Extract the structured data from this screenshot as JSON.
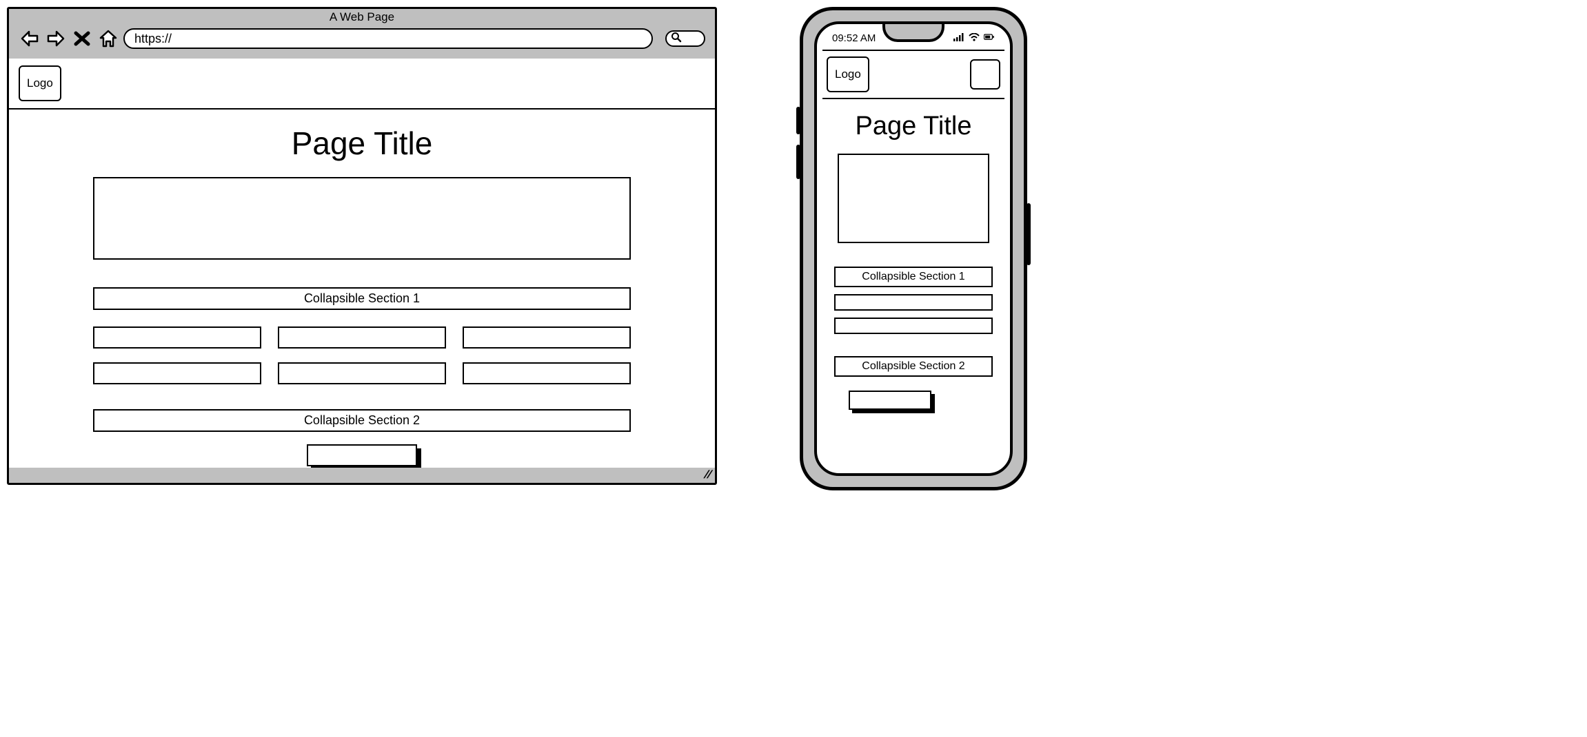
{
  "browser": {
    "window_title": "A Web Page",
    "url_prefix": "https://",
    "logo_label": "Logo",
    "page_title": "Page Title",
    "collapsible_1": "Collapsible Section 1",
    "collapsible_2": "Collapsible Section 2"
  },
  "phone": {
    "time": "09:52 AM",
    "logo_label": "Logo",
    "page_title": "Page Title",
    "collapsible_1": "Collapsible Section 1",
    "collapsible_2": "Collapsible Section 2"
  }
}
